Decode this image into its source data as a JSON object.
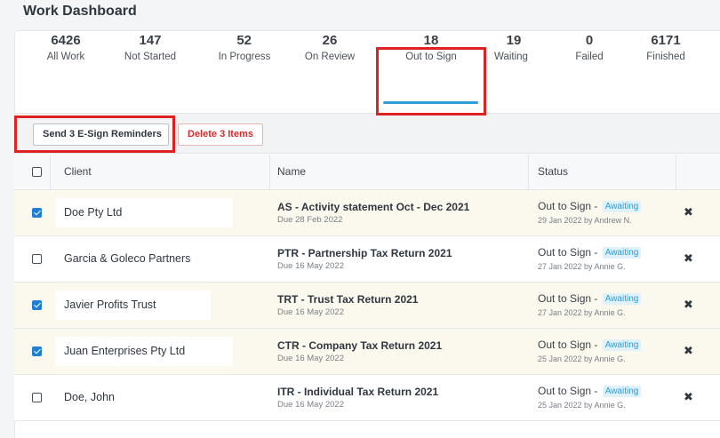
{
  "page_title": "Work Dashboard",
  "stats": [
    {
      "count": "6426",
      "label": "All Work"
    },
    {
      "count": "147",
      "label": "Not Started"
    },
    {
      "count": "52",
      "label": "In Progress"
    },
    {
      "count": "26",
      "label": "On Review"
    },
    {
      "count": "18",
      "label": "Out to Sign"
    },
    {
      "count": "19",
      "label": "Waiting"
    },
    {
      "count": "0",
      "label": "Failed"
    },
    {
      "count": "6171",
      "label": "Finished"
    }
  ],
  "active_stat": "Out to Sign",
  "toolbar": {
    "send_label": "Send 3 E-Sign Reminders",
    "delete_label": "Delete 3 Items"
  },
  "table": {
    "headers": {
      "client": "Client",
      "name": "Name",
      "status": "Status"
    },
    "rows": [
      {
        "checked": true,
        "client": "Doe Pty Ltd",
        "job": "AS - Activity statement Oct - Dec 2021",
        "due": "Due 28 Feb 2022",
        "status": "Out to Sign -",
        "badge": "Awaiting",
        "meta": "29 Jan 2022 by Andrew N.",
        "remove": "✖"
      },
      {
        "checked": false,
        "client": "Garcia & Goleco Partners",
        "job": "PTR - Partnership Tax Return 2021",
        "due": "Due 16 May 2022",
        "status": "Out to Sign -",
        "badge": "Awaiting",
        "meta": "27 Jan 2022 by Annie G.",
        "remove": "✖"
      },
      {
        "checked": true,
        "client": "Javier Profits Trust",
        "job": "TRT - Trust Tax Return 2021",
        "due": "Due 16 May 2022",
        "status": "Out to Sign -",
        "badge": "Awaiting",
        "meta": "27 Jan 2022 by Annie G.",
        "remove": "✖"
      },
      {
        "checked": true,
        "client": "Juan Enterprises Pty Ltd",
        "job": "CTR - Company Tax Return 2021",
        "due": "Due 16 May 2022",
        "status": "Out to Sign -",
        "badge": "Awaiting",
        "meta": "25 Jan 2022 by Annie G.",
        "remove": "✖"
      },
      {
        "checked": false,
        "client": "Doe, John",
        "job": "ITR - Individual Tax Return 2021",
        "due": "Due 16 May 2022",
        "status": "Out to Sign -",
        "badge": "Awaiting",
        "meta": "25 Jan 2022 by Annie G.",
        "remove": "✖"
      }
    ]
  },
  "colors": {
    "accent": "#2d9fd8",
    "checkbox": "#1e7fd6",
    "delete_red": "#d62b2b",
    "highlight_box": "#e02121",
    "selected_row": "#fbf8ee"
  }
}
